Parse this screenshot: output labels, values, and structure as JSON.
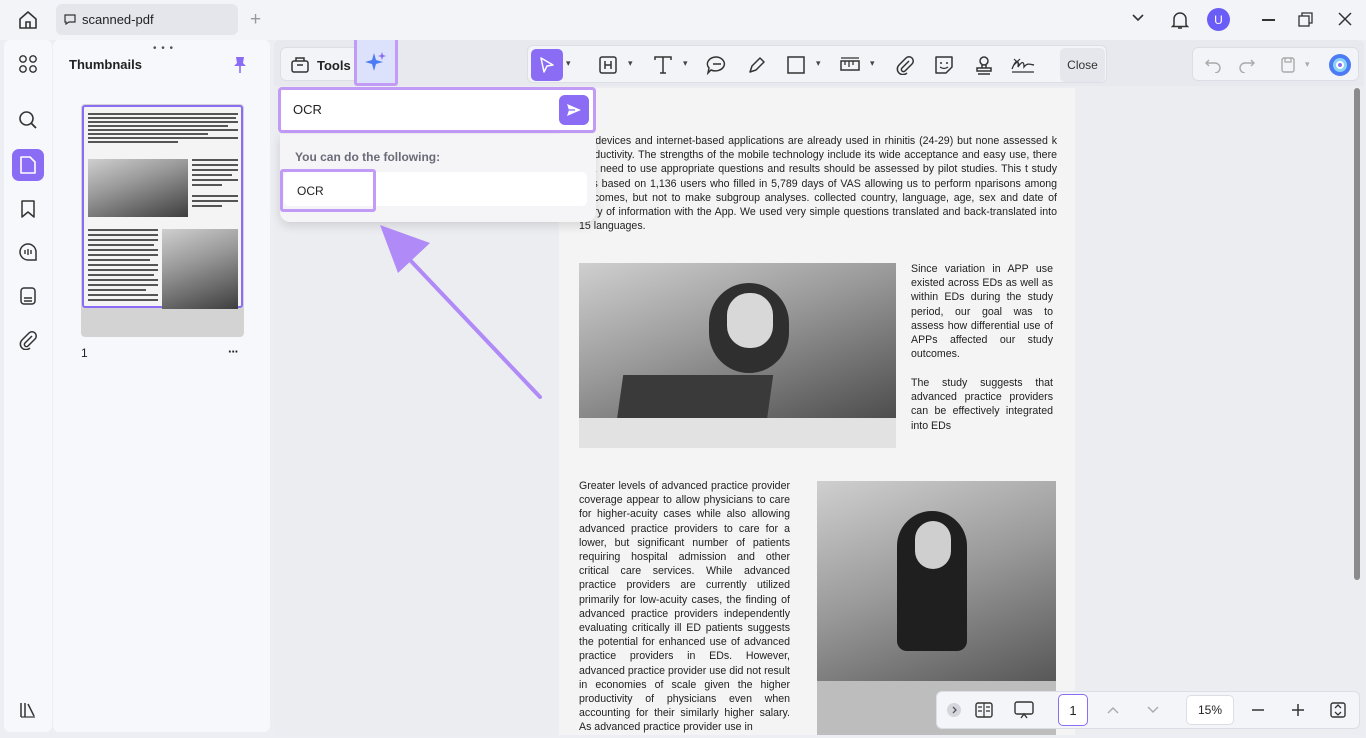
{
  "titlebar": {
    "tab_label": "scanned-pdf",
    "avatar_initial": "U"
  },
  "thumbnails": {
    "title": "Thumbnails",
    "page_number": "1",
    "more": "···"
  },
  "toolbar": {
    "tools_label": "Tools",
    "close_label": "Close"
  },
  "ai_popup": {
    "input_value": "OCR",
    "hint": "You can do the following:",
    "option": "OCR"
  },
  "document": {
    "paragraph1": "art devices and internet-based applications are already used in rhinitis (24-29) but none assessed k productivity. The strengths of the mobile technology include its wide acceptance and easy use, there is a need to use appropriate questions and results should be assessed by pilot studies. This t study was based on 1,136 users who filled in 5,789 days of VAS allowing us to perform nparisons among outcomes, but not to make subgroup analyses. collected country, language, age, sex and date of entry of information with the App. We used very simple questions translated and back-translated into 15 languages.",
    "side1": "Since variation in APP use existed across EDs as well as within EDs during the study period, our goal was to assess how differential use of APPs affected our study outcomes.",
    "side2": "The study suggests that advanced practice providers can be effectively integrated into EDs",
    "paragraph2": "Greater levels of advanced practice provider coverage appear to allow physicians to care for higher-acuity cases while also allowing advanced practice providers to care for a lower, but significant number of patients requiring hospital admission and other critical care services. While advanced practice providers are currently utilized primarily for low-acuity cases, the finding of advanced practice providers independently evaluating critically ill ED patients suggests the potential for enhanced use of advanced practice providers in EDs. However, advanced practice provider use did not result in economies of scale given the higher productivity of physicians even when accounting for their similarly higher salary. As advanced practice provider use in"
  },
  "bottom": {
    "page_value": "1",
    "zoom": "15%"
  },
  "colors": {
    "accent": "#8a6cf5",
    "highlight": "#c29bf7",
    "arrow": "#b08af7"
  }
}
